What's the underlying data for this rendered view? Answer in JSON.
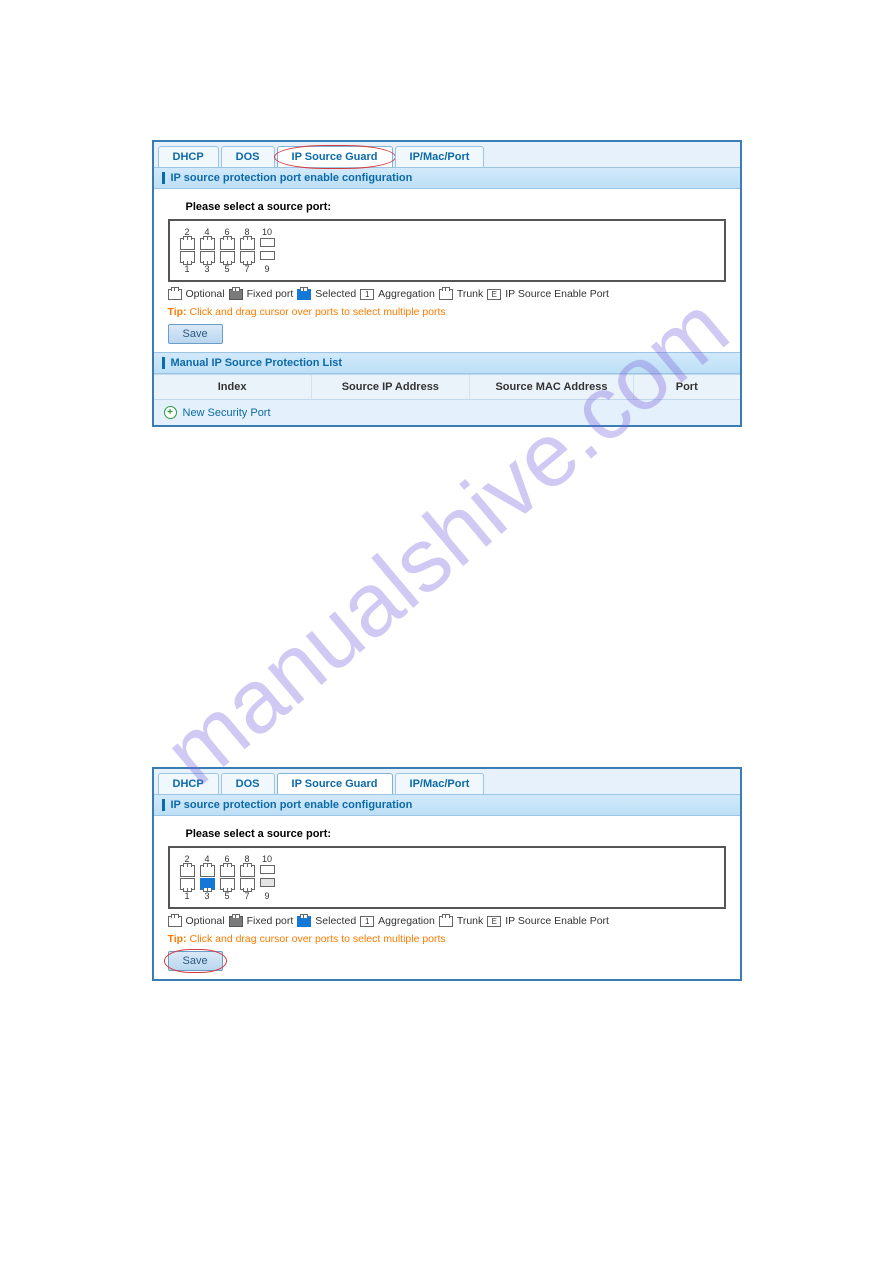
{
  "watermark": "manualshive.com",
  "tabs": [
    "DHCP",
    "DOS",
    "IP Source Guard",
    "IP/Mac/Port"
  ],
  "section_header": "IP source protection port enable configuration",
  "source_port_label": "Please select a source port:",
  "ports_top": [
    "2",
    "4",
    "6",
    "8",
    "10"
  ],
  "ports_bottom": [
    "1",
    "3",
    "5",
    "7",
    "9"
  ],
  "legend": {
    "optional": "Optional",
    "fixed": "Fixed port",
    "selected": "Selected",
    "aggregation": "Aggregation",
    "trunk": "Trunk",
    "enable": "IP Source Enable Port"
  },
  "tip_label": "Tip:",
  "tip_text": "Click and drag cursor over ports to select multiple ports",
  "save_label": "Save",
  "manual_list_header": "Manual IP Source Protection List",
  "table_headers": {
    "index": "Index",
    "ip": "Source IP Address",
    "mac": "Source MAC Address",
    "port": "Port"
  },
  "new_security_port": "New Security Port"
}
